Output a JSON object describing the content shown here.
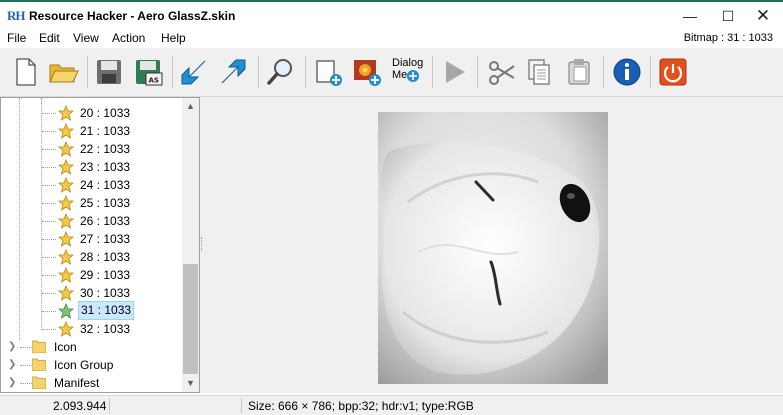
{
  "titlebar": {
    "title": "Resource Hacker - Aero GlassZ.skin",
    "logo": "RH"
  },
  "menubar": {
    "items": [
      "File",
      "Edit",
      "View",
      "Action",
      "Help"
    ],
    "bitmap_info": "Bitmap : 31 : 1033"
  },
  "toolbar": {
    "dialog_label_1": "Dialog",
    "dialog_label_2": "Me"
  },
  "tree": {
    "bitmap_entries": [
      "20 : 1033",
      "21 : 1033",
      "22 : 1033",
      "23 : 1033",
      "24 : 1033",
      "25 : 1033",
      "26 : 1033",
      "27 : 1033",
      "28 : 1033",
      "29 : 1033",
      "30 : 1033",
      "31 : 1033",
      "32 : 1033"
    ],
    "selected_entry": "31 : 1033",
    "groups": [
      "Icon",
      "Icon Group",
      "Manifest"
    ]
  },
  "statusbar": {
    "offset": "2.093.944",
    "image_info": "Size: 666 × 786;  bpp:32;  hdr:v1;  type:RGB"
  },
  "colors": {
    "accent_top": "#1e6f5c",
    "selection": "#cce8ff",
    "star": "#f2c94c"
  }
}
